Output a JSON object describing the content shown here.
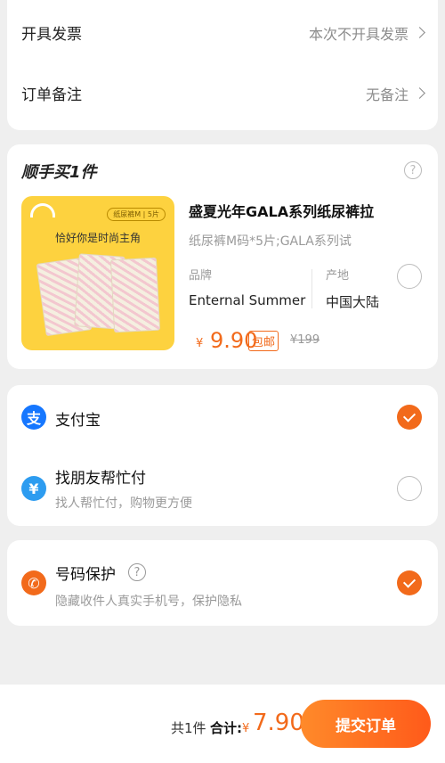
{
  "invoice": {
    "label": "开具发票",
    "value": "本次不开具发票"
  },
  "remark": {
    "label": "订单备注",
    "value": "无备注"
  },
  "add_on": {
    "title": "顺手买1件",
    "product": {
      "image_tag": "纸尿裤M | 5片",
      "image_slogan": "恰好你是时尚主角",
      "name": "盛夏光年GALA系列纸尿裤拉",
      "subtitle": "纸尿裤M码*5片;GALA系列试",
      "brand_key": "品牌",
      "brand_value": "Enternal Summer",
      "origin_key": "产地",
      "origin_value": "中国大陆",
      "currency": "¥",
      "price": "9.90",
      "badge": "包邮",
      "original_price": "¥199",
      "selected": false
    }
  },
  "payment": {
    "alipay": {
      "label": "支付宝",
      "icon": "alipay-icon",
      "selected": true,
      "color": "#1677ff"
    },
    "friend_pay": {
      "label": "找朋友帮忙付",
      "sub": "找人帮忙付，购物更方便",
      "icon": "friend-pay-icon",
      "selected": false,
      "color": "#2d9cf0"
    }
  },
  "privacy": {
    "label": "号码保护",
    "sub": "隐藏收件人真实手机号，保护隐私",
    "icon": "shield-phone-icon",
    "selected": true,
    "color": "#f26a1b"
  },
  "footer": {
    "count": "共1件",
    "total_label": "合计:",
    "currency": "¥",
    "total": "7.90",
    "submit": "提交订单"
  },
  "accent_color": "#f26a1b"
}
